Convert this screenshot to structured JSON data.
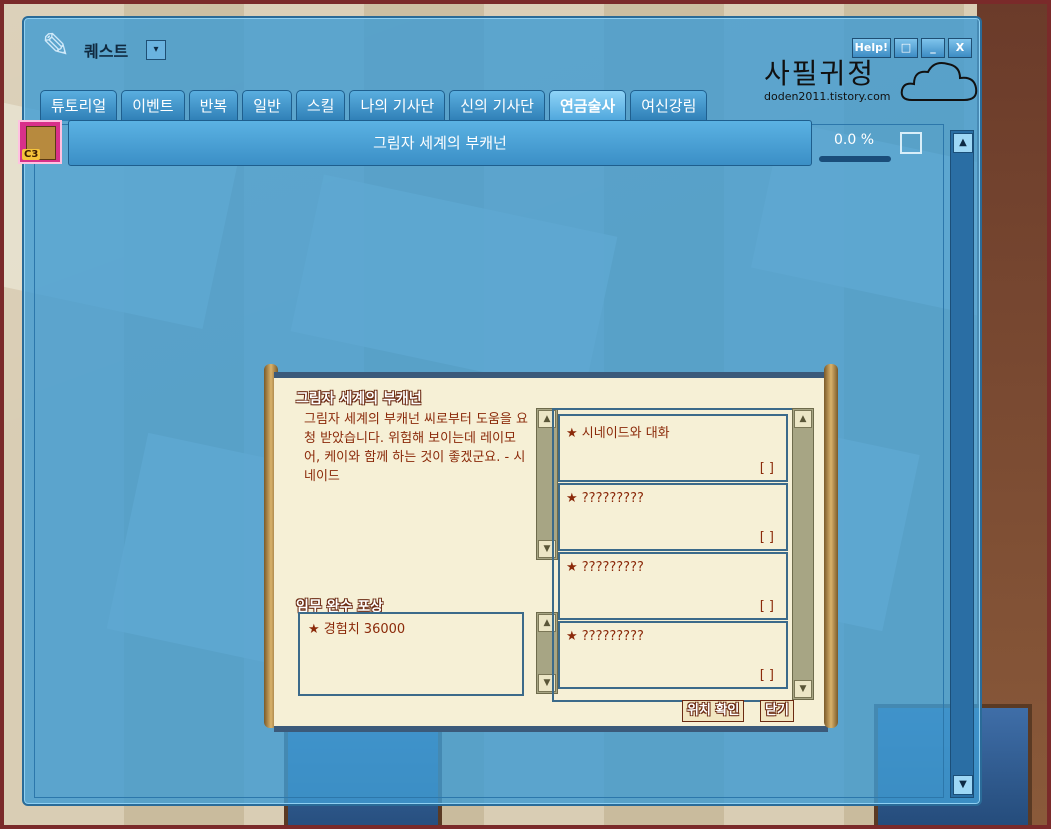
{
  "window": {
    "title": "퀘스트",
    "dropdown_glyph": "▾",
    "buttons": {
      "help": "Help!",
      "restore": "□",
      "minimize": "_",
      "close": "X"
    }
  },
  "tabs": [
    {
      "label": "튜토리얼"
    },
    {
      "label": "이벤트"
    },
    {
      "label": "반복"
    },
    {
      "label": "일반"
    },
    {
      "label": "스킬"
    },
    {
      "label": "나의 기사단"
    },
    {
      "label": "신의 기사단"
    },
    {
      "label": "연금술사",
      "active": true
    },
    {
      "label": "여신강림"
    }
  ],
  "watermark": {
    "title": "사필귀정",
    "url": "doden2011.tistory.com"
  },
  "quest": {
    "icon_badge": "C3",
    "name": "그림자 세계의 부캐넌",
    "progress_text": "0.0 %",
    "progress": 0.0
  },
  "dialog": {
    "title": "그림자 세계의 부캐넌",
    "description": "그림자 세계의 부캐넌 씨로부터 도움을 요청 받았습니다. 위험해 보이는데 레이모어, 케이와 함께 하는 것이 좋겠군요. - 시네이드",
    "reward_title": "임무 완수 포상",
    "reward": "★ 경험치 36000",
    "objectives": [
      {
        "text": "★ 시네이드와 대화",
        "status": "[   ]"
      },
      {
        "text": "★ ?????????",
        "status": "[   ]"
      },
      {
        "text": "★ ?????????",
        "status": "[   ]"
      },
      {
        "text": "★ ?????????",
        "status": "[   ]"
      }
    ],
    "buttons": {
      "locate": "위치 확인",
      "close": "닫기"
    }
  },
  "colors": {
    "window_bg": "#409bd2",
    "scroll_text": "#8b2a0a",
    "frame": "#7a2a2a"
  }
}
